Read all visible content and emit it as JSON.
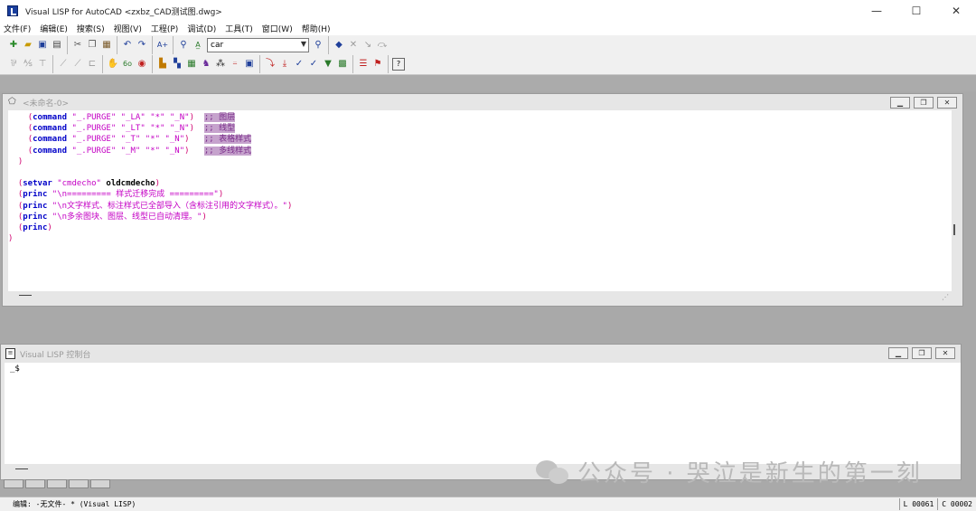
{
  "window": {
    "title": "Visual LISP for AutoCAD <zxbz_CAD测试图.dwg>",
    "controls": {
      "minimize": "—",
      "maximize": "☐",
      "close": "✕"
    }
  },
  "menu": [
    "文件(F)",
    "编辑(E)",
    "搜索(S)",
    "视图(V)",
    "工程(P)",
    "调试(D)",
    "工具(T)",
    "窗口(W)",
    "帮助(H)"
  ],
  "toolbar": {
    "search_combo_value": "car",
    "row1_groups": [
      [
        "new-file-icon",
        "open-file-icon",
        "save-icon",
        "print-icon"
      ],
      [
        "cut-icon",
        "copy-icon",
        "paste-icon"
      ],
      [
        "undo-icon",
        "redo-icon"
      ],
      [
        "complete-word-icon"
      ],
      [
        "find-icon",
        "apropos-icon"
      ],
      [
        "search-combo"
      ],
      [
        "load-icon"
      ],
      [
        "toggle-breakpoint-icon",
        "clear-breakpoints-icon",
        "step-icon",
        "continue-icon"
      ]
    ],
    "row2_groups": [
      [
        "format-icon",
        "format-selection-icon",
        "check-icon"
      ],
      [
        "comment-icon",
        "uncomment-icon",
        "load-selection-icon"
      ],
      [
        "hand-icon",
        "inspect-icon",
        "trace-icon"
      ],
      [
        "activate-autocad-icon",
        "load-active-window-icon",
        "check-text-icon",
        "inspect-object-icon",
        "symbol-service-icon",
        "watch-icon",
        "apropos-window-icon"
      ],
      [
        "step-into-icon",
        "step-over-icon",
        "step-out-icon",
        "continue-run-icon",
        "quit-icon",
        "reset-icon"
      ],
      [
        "add-watch-icon",
        "last-break-icon"
      ],
      [
        "help-icon"
      ]
    ]
  },
  "editor": {
    "title": "<未命名-0>",
    "lines": [
      [
        [
          "    ",
          ""
        ],
        [
          "(",
          "paren"
        ],
        [
          "command",
          "sym"
        ],
        [
          " ",
          ""
        ],
        [
          "\"_.PURGE\"",
          "str"
        ],
        [
          " ",
          ""
        ],
        [
          "\"_LA\"",
          "str"
        ],
        [
          " ",
          ""
        ],
        [
          "\"*\"",
          "str"
        ],
        [
          " ",
          ""
        ],
        [
          "\"_N\"",
          "str"
        ],
        [
          ")",
          "paren"
        ],
        [
          "  ",
          ""
        ],
        [
          ";; 图层",
          "cmt"
        ]
      ],
      [
        [
          "    ",
          ""
        ],
        [
          "(",
          "paren"
        ],
        [
          "command",
          "sym"
        ],
        [
          " ",
          ""
        ],
        [
          "\"_.PURGE\"",
          "str"
        ],
        [
          " ",
          ""
        ],
        [
          "\"_LT\"",
          "str"
        ],
        [
          " ",
          ""
        ],
        [
          "\"*\"",
          "str"
        ],
        [
          " ",
          ""
        ],
        [
          "\"_N\"",
          "str"
        ],
        [
          ")",
          "paren"
        ],
        [
          "  ",
          ""
        ],
        [
          ";; 线型",
          "cmt"
        ]
      ],
      [
        [
          "    ",
          ""
        ],
        [
          "(",
          "paren"
        ],
        [
          "command",
          "sym"
        ],
        [
          " ",
          ""
        ],
        [
          "\"_.PURGE\"",
          "str"
        ],
        [
          " ",
          ""
        ],
        [
          "\"_T\"",
          "str"
        ],
        [
          " ",
          ""
        ],
        [
          "\"*\"",
          "str"
        ],
        [
          " ",
          ""
        ],
        [
          "\"_N\"",
          "str"
        ],
        [
          ")",
          "paren"
        ],
        [
          "   ",
          ""
        ],
        [
          ";; 表格样式",
          "cmt"
        ]
      ],
      [
        [
          "    ",
          ""
        ],
        [
          "(",
          "paren"
        ],
        [
          "command",
          "sym"
        ],
        [
          " ",
          ""
        ],
        [
          "\"_.PURGE\"",
          "str"
        ],
        [
          " ",
          ""
        ],
        [
          "\"_M\"",
          "str"
        ],
        [
          " ",
          ""
        ],
        [
          "\"*\"",
          "str"
        ],
        [
          " ",
          ""
        ],
        [
          "\"_N\"",
          "str"
        ],
        [
          ")",
          "paren"
        ],
        [
          "   ",
          ""
        ],
        [
          ";; 多线样式",
          "cmt"
        ]
      ],
      [
        [
          "  ",
          ""
        ],
        [
          ")",
          "paren"
        ]
      ],
      [
        [
          "",
          ""
        ]
      ],
      [
        [
          "  ",
          ""
        ],
        [
          "(",
          "paren"
        ],
        [
          "setvar",
          "sym"
        ],
        [
          " ",
          ""
        ],
        [
          "\"cmdecho\"",
          "str"
        ],
        [
          " ",
          ""
        ],
        [
          "oldcmdecho",
          "var"
        ],
        [
          ")",
          "paren"
        ]
      ],
      [
        [
          "  ",
          ""
        ],
        [
          "(",
          "paren"
        ],
        [
          "princ",
          "sym"
        ],
        [
          " ",
          ""
        ],
        [
          "\"\\n========= 样式迁移完成 =========\"",
          "str"
        ],
        [
          ")",
          "paren"
        ]
      ],
      [
        [
          "  ",
          ""
        ],
        [
          "(",
          "paren"
        ],
        [
          "princ",
          "sym"
        ],
        [
          " ",
          ""
        ],
        [
          "\"\\n文字样式、标注样式已全部导入（含标注引用的文字样式）。\"",
          "str"
        ],
        [
          ")",
          "paren"
        ]
      ],
      [
        [
          "  ",
          ""
        ],
        [
          "(",
          "paren"
        ],
        [
          "princ",
          "sym"
        ],
        [
          " ",
          ""
        ],
        [
          "\"\\n多余图块、图层、线型已自动清理。\"",
          "str"
        ],
        [
          ")",
          "paren"
        ]
      ],
      [
        [
          "  ",
          ""
        ],
        [
          "(",
          "paren"
        ],
        [
          "princ",
          "sym"
        ],
        [
          ")",
          "paren"
        ]
      ],
      [
        [
          "",
          ""
        ],
        [
          ")",
          "paren"
        ]
      ]
    ]
  },
  "console": {
    "title": "Visual LISP 控制台",
    "prompt": "_$"
  },
  "statusbar": {
    "left": "编辑: -无文件- * (Visual LISP)",
    "line": "L 00061",
    "col": "C 00002"
  },
  "watermark": "公众号 · 哭泣是新生的第一刻",
  "colors": {
    "paren": "#d0006f",
    "symbol": "#0000c8",
    "string": "#c400c4",
    "comment_bg": "#c6a3cd",
    "mdi_background": "#a9a9a9"
  }
}
